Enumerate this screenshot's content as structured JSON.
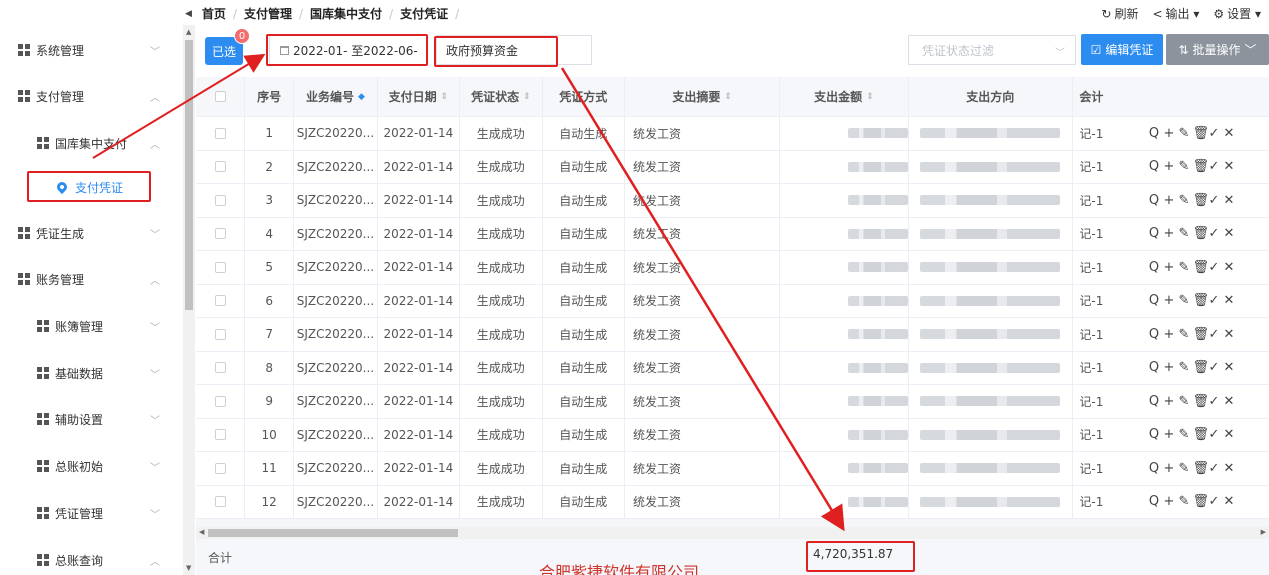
{
  "breadcrumb": {
    "back_icon": "caret-left-icon",
    "items": [
      "首页",
      "支付管理",
      "国库集中支付",
      "支付凭证"
    ],
    "trailing_separator": "/"
  },
  "top_actions": [
    {
      "icon": "refresh-icon",
      "label": "刷新"
    },
    {
      "icon": "share-icon",
      "label": "输出 ▾"
    },
    {
      "icon": "gear-icon",
      "label": "设置 ▾"
    }
  ],
  "sidebar": {
    "items": [
      {
        "label": "系统管理",
        "chev": "﹀"
      },
      {
        "label": "支付管理",
        "chev": "︿"
      },
      {
        "label": "国库集中支付",
        "chev": "︿"
      },
      {
        "label": "支付凭证",
        "chev": ""
      },
      {
        "label": "凭证生成",
        "chev": "﹀"
      },
      {
        "label": "账务管理",
        "chev": "︿"
      },
      {
        "label": "账簿管理",
        "chev": "﹀"
      },
      {
        "label": "基础数据",
        "chev": "﹀"
      },
      {
        "label": "辅助设置",
        "chev": "﹀"
      },
      {
        "label": "总账初始",
        "chev": "﹀"
      },
      {
        "label": "凭证管理",
        "chev": "﹀"
      },
      {
        "label": "总账查询",
        "chev": "︿"
      }
    ]
  },
  "toolbar": {
    "selected_label": "已选",
    "selected_count": "0",
    "date_range": "2022-01- 至2022-06-",
    "fund_source": "政府预算资金",
    "status_filter_placeholder": "凭证状态过滤",
    "edit_button": "编辑凭证",
    "batch_button": "批量操作"
  },
  "table": {
    "headers": [
      "序号",
      "业务编号",
      "支付日期",
      "凭证状态",
      "凭证方式",
      "支出摘要",
      "支出金额",
      "支出方向",
      "会计"
    ],
    "rows": [
      {
        "no": "1",
        "code": "SJZC20220...",
        "date": "2022-01-14",
        "status": "生成成功",
        "mode": "自动生成",
        "summary": "统发工资",
        "acct": "记-1"
      },
      {
        "no": "2",
        "code": "SJZC20220...",
        "date": "2022-01-14",
        "status": "生成成功",
        "mode": "自动生成",
        "summary": "统发工资",
        "acct": "记-1"
      },
      {
        "no": "3",
        "code": "SJZC20220...",
        "date": "2022-01-14",
        "status": "生成成功",
        "mode": "自动生成",
        "summary": "统发工资",
        "acct": "记-1"
      },
      {
        "no": "4",
        "code": "SJZC20220...",
        "date": "2022-01-14",
        "status": "生成成功",
        "mode": "自动生成",
        "summary": "统发工资",
        "acct": "记-1"
      },
      {
        "no": "5",
        "code": "SJZC20220...",
        "date": "2022-01-14",
        "status": "生成成功",
        "mode": "自动生成",
        "summary": "统发工资",
        "acct": "记-1"
      },
      {
        "no": "6",
        "code": "SJZC20220...",
        "date": "2022-01-14",
        "status": "生成成功",
        "mode": "自动生成",
        "summary": "统发工资",
        "acct": "记-1"
      },
      {
        "no": "7",
        "code": "SJZC20220...",
        "date": "2022-01-14",
        "status": "生成成功",
        "mode": "自动生成",
        "summary": "统发工资",
        "acct": "记-1"
      },
      {
        "no": "8",
        "code": "SJZC20220...",
        "date": "2022-01-14",
        "status": "生成成功",
        "mode": "自动生成",
        "summary": "统发工资",
        "acct": "记-1"
      },
      {
        "no": "9",
        "code": "SJZC20220...",
        "date": "2022-01-14",
        "status": "生成成功",
        "mode": "自动生成",
        "summary": "统发工资",
        "acct": "记-1"
      },
      {
        "no": "10",
        "code": "SJZC20220...",
        "date": "2022-01-14",
        "status": "生成成功",
        "mode": "自动生成",
        "summary": "统发工资",
        "acct": "记-1"
      },
      {
        "no": "11",
        "code": "SJZC20220...",
        "date": "2022-01-14",
        "status": "生成成功",
        "mode": "自动生成",
        "summary": "统发工资",
        "acct": "记-1"
      },
      {
        "no": "12",
        "code": "SJZC20220...",
        "date": "2022-01-14",
        "status": "生成成功",
        "mode": "自动生成",
        "summary": "统发工资",
        "acct": "记-1"
      }
    ],
    "row_actions": [
      "view-icon",
      "add-icon",
      "edit-icon",
      "delete-icon",
      "approve-icon",
      "reject-icon"
    ]
  },
  "footer": {
    "sum_label": "合计",
    "total_amount": "4,720,351.87",
    "company": "合肥紫捷软件有限公司"
  },
  "colors": {
    "primary": "#2d8cf0",
    "annotation": "#e02020",
    "company_text": "#d0342c"
  }
}
